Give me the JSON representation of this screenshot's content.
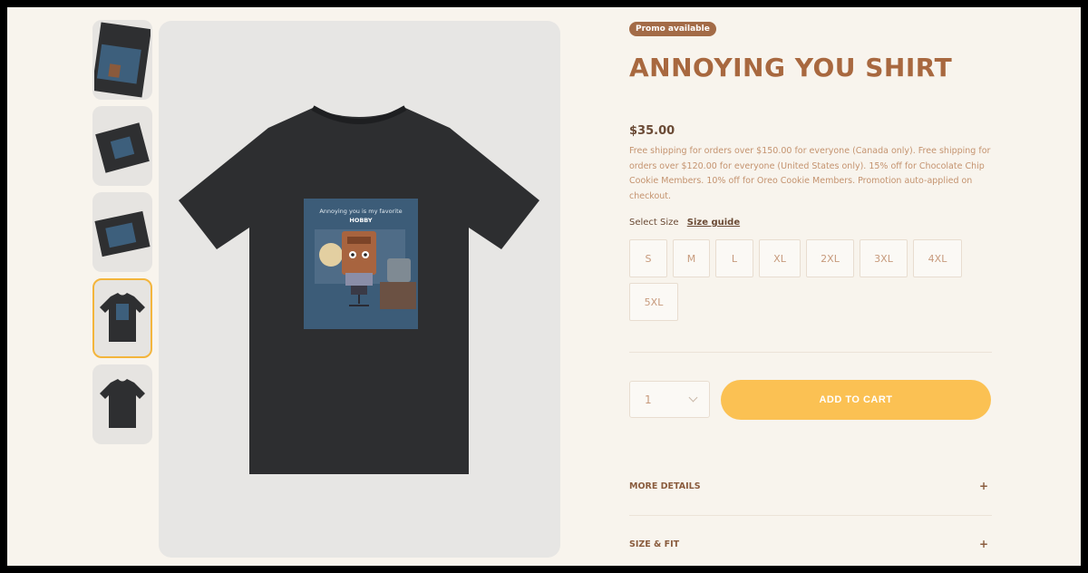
{
  "gallery": {
    "thumbnails": [
      {
        "label": "thumbnail-1",
        "active": false
      },
      {
        "label": "thumbnail-2",
        "active": false
      },
      {
        "label": "thumbnail-3",
        "active": false
      },
      {
        "label": "thumbnail-4",
        "active": true
      },
      {
        "label": "thumbnail-5",
        "active": false
      }
    ],
    "print": {
      "line1": "Annoying you is my favorite",
      "line2": "HOBBY"
    }
  },
  "product": {
    "promo_badge": "Promo available",
    "title": "ANNOYING YOU SHIRT",
    "price": "$35.00",
    "shipping_note": "Free shipping for orders over $150.00 for everyone (Canada only). Free shipping for orders over $120.00 for everyone (United States only). 15% off for Chocolate Chip Cookie Members. 10% off for Oreo Cookie Members. Promotion auto-applied on checkout.",
    "select_size_label": "Select Size",
    "size_guide_label": "Size guide",
    "sizes": [
      "S",
      "M",
      "L",
      "XL",
      "2XL",
      "3XL",
      "4XL",
      "5XL"
    ],
    "quantity": "1",
    "add_to_cart_label": "ADD TO CART",
    "accordion": {
      "more_details": "MORE DETAILS",
      "size_fit": "SIZE & FIT",
      "toggle_symbol": "+"
    }
  },
  "colors": {
    "background": "#f8f4ed",
    "accent": "#fbc153",
    "title": "#a8683f",
    "promo": "#a36b47",
    "active_thumb_border": "#f3b53c"
  }
}
